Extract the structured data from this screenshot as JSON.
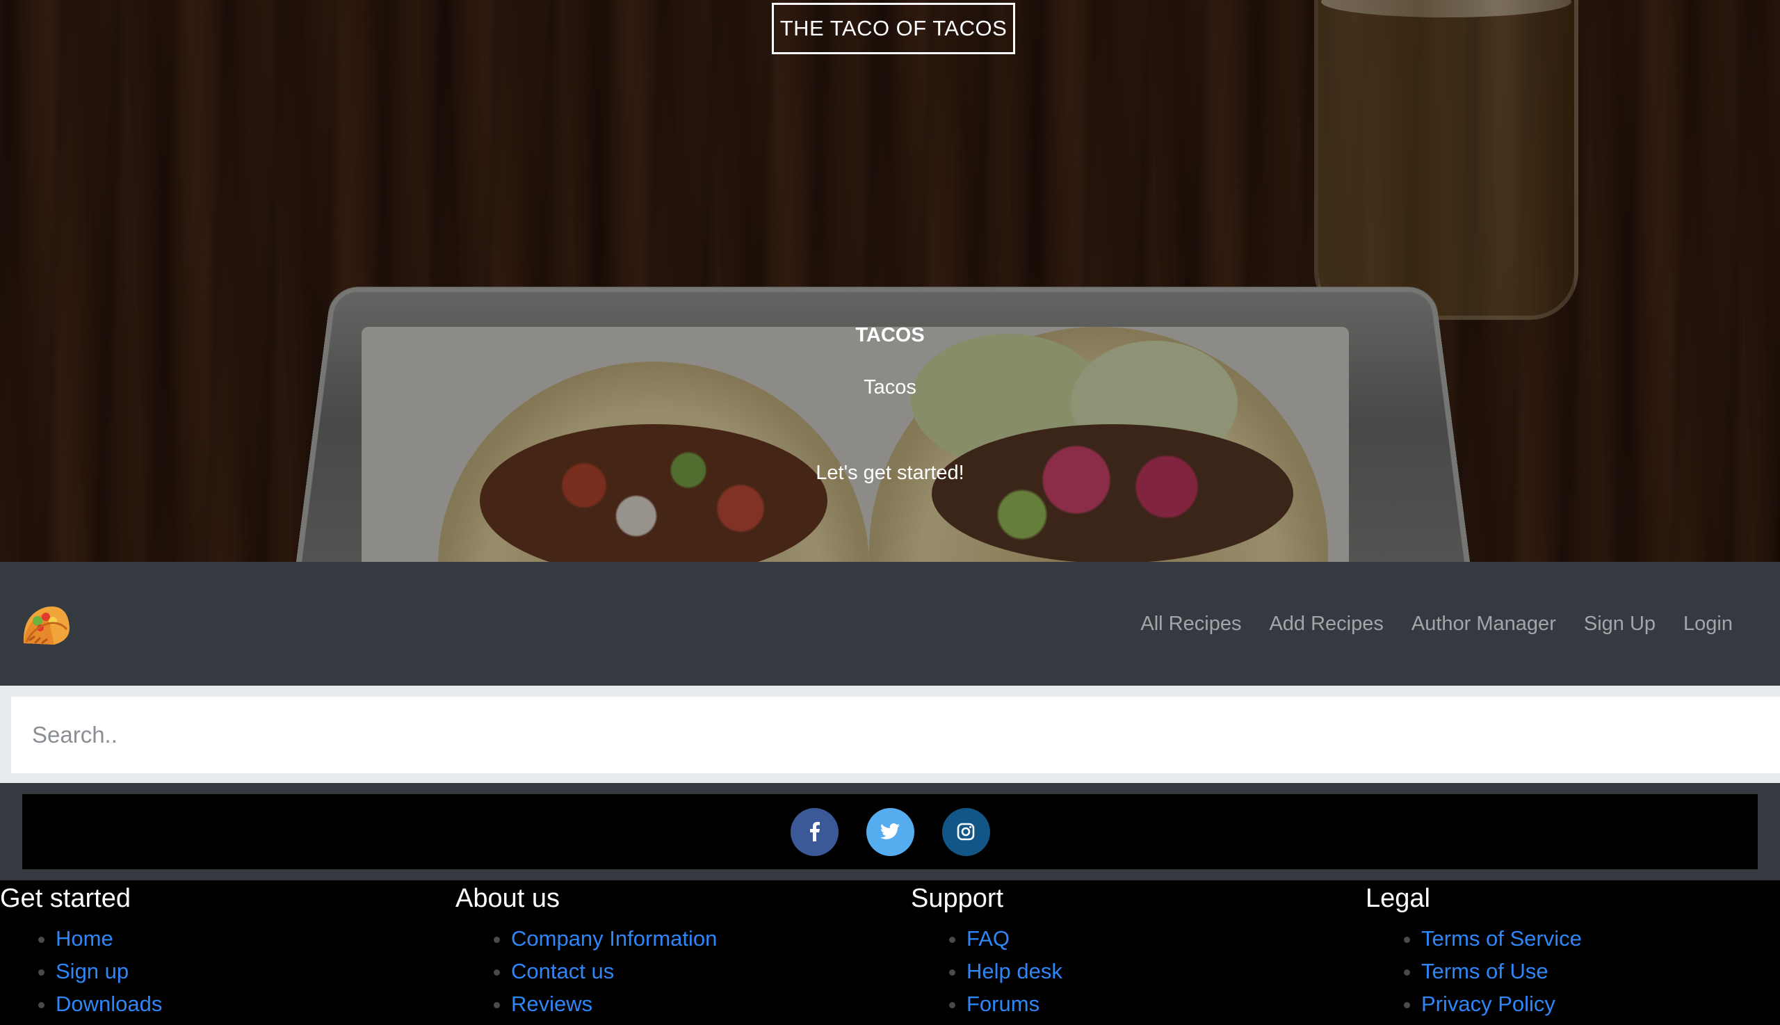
{
  "hero": {
    "brand": "THE TACO OF TACOS",
    "title": "TACOS",
    "subtitle": "Tacos",
    "cta": "Let's get started!"
  },
  "navbar": {
    "logo_icon": "taco-icon",
    "links": [
      "All Recipes",
      "Add Recipes",
      "Author Manager",
      "Sign Up",
      "Login"
    ]
  },
  "search": {
    "placeholder": "Search.."
  },
  "social": {
    "buttons": [
      {
        "icon": "facebook-icon",
        "color": "#3b5998"
      },
      {
        "icon": "twitter-icon",
        "color": "#55acee"
      },
      {
        "icon": "instagram-icon",
        "color": "#125688"
      }
    ]
  },
  "footer": {
    "columns": [
      {
        "heading": "Get started",
        "links": [
          "Home",
          "Sign up",
          "Downloads"
        ]
      },
      {
        "heading": "About us",
        "links": [
          "Company Information",
          "Contact us",
          "Reviews"
        ]
      },
      {
        "heading": "Support",
        "links": [
          "FAQ",
          "Help desk",
          "Forums"
        ]
      },
      {
        "heading": "Legal",
        "links": [
          "Terms of Service",
          "Terms of Use",
          "Privacy Policy"
        ]
      }
    ]
  },
  "colors": {
    "navbar_bg": "#343a40",
    "nav_link": "#a3a6a9",
    "footer_link": "#2f86f6"
  }
}
